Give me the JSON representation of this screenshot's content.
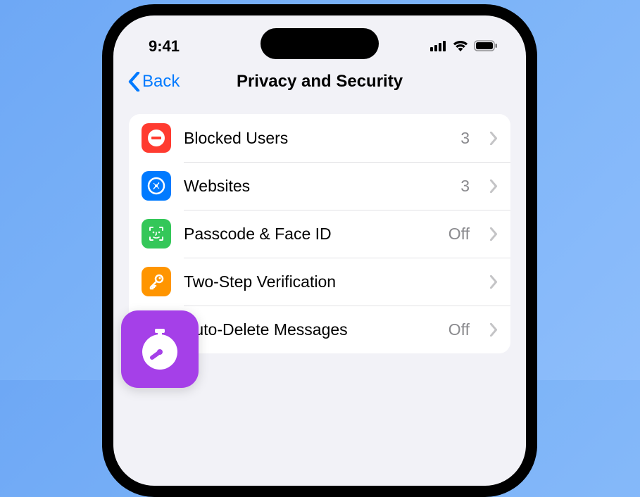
{
  "status": {
    "time": "9:41"
  },
  "nav": {
    "back_label": "Back",
    "title": "Privacy and Security"
  },
  "rows": [
    {
      "label": "Blocked Users",
      "value": "3",
      "icon": "blocked",
      "color": "#ff3b30"
    },
    {
      "label": "Websites",
      "value": "3",
      "icon": "compass",
      "color": "#007aff"
    },
    {
      "label": "Passcode & Face ID",
      "value": "Off",
      "icon": "faceid",
      "color": "#34c759"
    },
    {
      "label": "Two-Step Verification",
      "value": "",
      "icon": "key",
      "color": "#ff9500"
    },
    {
      "label": "Auto-Delete Messages",
      "value": "Off",
      "icon": "timer",
      "color": "#af52de"
    }
  ],
  "overlay": {
    "icon": "stopwatch",
    "color": "#a540e8"
  }
}
